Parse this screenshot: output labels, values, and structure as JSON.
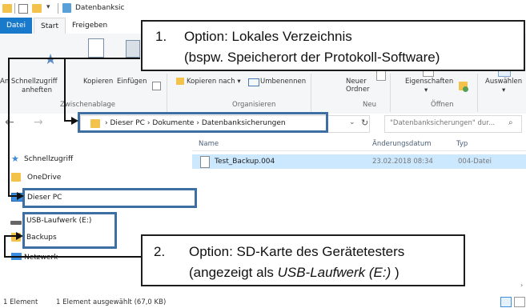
{
  "window": {
    "title": "Datenbanksic"
  },
  "tabs": {
    "datei": "Datei",
    "start": "Start",
    "freigeben": "Freigeben"
  },
  "ribbon": {
    "pin_label_1": "An Schnellzugriff",
    "pin_label_2": "anheften",
    "copy": "Kopieren",
    "paste": "Einfügen",
    "copy_to": "Kopieren nach ▾",
    "rename": "Umbenennen",
    "new_folder_1": "Neuer",
    "new_folder_2": "Ordner",
    "properties_1": "Eigenschaften",
    "properties_2": "▾",
    "select_1": "Auswählen",
    "select_2": "▾",
    "group_clipboard": "Zwischenablage",
    "group_organize": "Organisieren",
    "group_new": "Neu",
    "group_open": "Öffnen"
  },
  "address": {
    "crumbs": [
      "Dieser PC",
      "Dokumente",
      "Datenbanksicherungen"
    ],
    "sep": "›",
    "dropdown": "⌵",
    "refresh": "↻",
    "search_placeholder": "\"Datenbanksicherungen\" dur...",
    "back": "←",
    "forward": "→"
  },
  "nav": {
    "quick_access": "Schnellzugriff",
    "onedrive": "OneDrive",
    "this_pc": "Dieser PC",
    "usb": "USB-Laufwerk (E:)",
    "backups": "Backups",
    "network": "Netzwerk"
  },
  "content": {
    "columns": [
      "Name",
      "Änderungsdatum",
      "Typ"
    ],
    "files": [
      {
        "name": "Test_Backup.004",
        "date": "23.02.2018 08:34",
        "type": "004-Datei"
      }
    ]
  },
  "status": {
    "count": "1 Element",
    "selected": "1 Element ausgewählt (67,0 KB)"
  },
  "callouts": {
    "one": {
      "num": "1.",
      "line1": "Option: Lokales Verzeichnis",
      "line2": "(bspw. Speicherort der Protokoll-Software)"
    },
    "two": {
      "num": "2.",
      "line1": "Option: SD-Karte des Gerätetesters",
      "line2_pre": "(angezeigt als ",
      "line2_em": "USB-Laufwerk (E:)",
      "line2_post": " )"
    }
  },
  "colors": {
    "accent": "#1979ca",
    "highlight_border": "#3d6fa3",
    "selection": "#cce8ff",
    "folder": "#f3c24a"
  }
}
